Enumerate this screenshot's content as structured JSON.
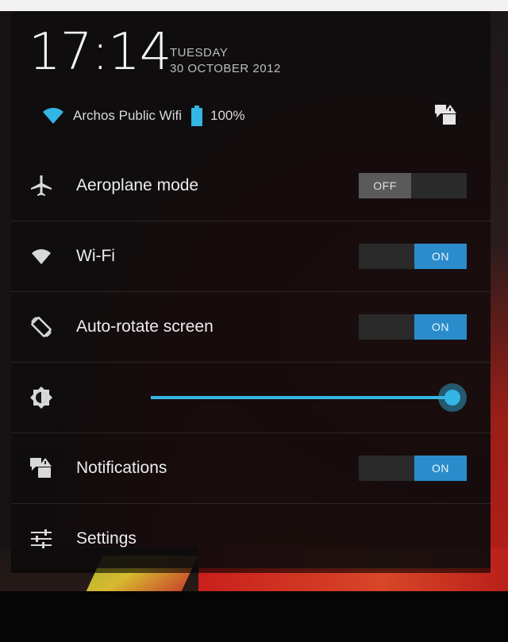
{
  "header": {
    "time": "17:14",
    "day": "TUESDAY",
    "date": "30 OCTOBER 2012",
    "wifi_name": "Archos Public Wifi",
    "battery_percent": "100%",
    "battery_level": 1.0,
    "wifi_icon": "wifi-icon",
    "battery_icon": "battery-icon",
    "notifications_icon": "notifications-icon"
  },
  "settings": {
    "aeroplane": {
      "label": "Aeroplane mode",
      "state": "OFF",
      "icon": "airplane-icon"
    },
    "wifi": {
      "label": "Wi-Fi",
      "state": "ON",
      "icon": "wifi-icon"
    },
    "autorotate": {
      "label": "Auto-rotate screen",
      "state": "ON",
      "icon": "rotate-icon"
    },
    "brightness": {
      "level": 1.0,
      "icon": "brightness-icon"
    },
    "notifications": {
      "label": "Notifications",
      "state": "ON",
      "icon": "notifications-icon"
    },
    "settings_item": {
      "label": "Settings",
      "icon": "sliders-icon"
    }
  },
  "colors": {
    "accent": "#33b5e5",
    "toggle_on": "#2a8ccb",
    "toggle_off": "#5a5a5a",
    "panel": "#0e0c0d"
  }
}
